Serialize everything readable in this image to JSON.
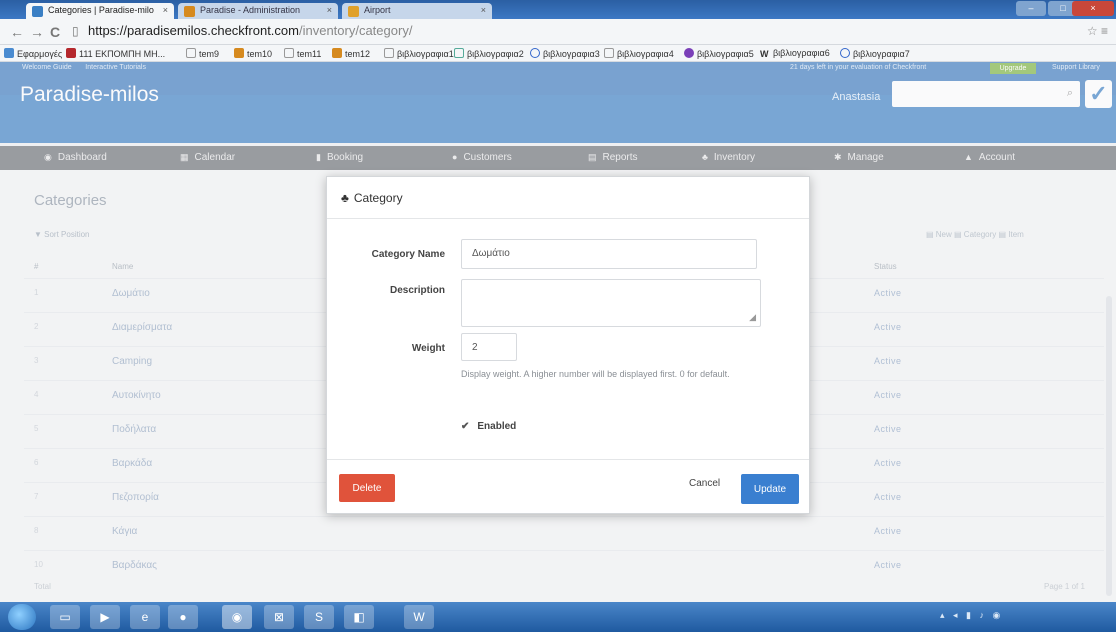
{
  "browser": {
    "tabs": [
      {
        "title": "Categories | Paradise-milo",
        "active": true,
        "favicon_color": "#3a7fc4"
      },
      {
        "title": "Paradise - Administration",
        "active": false,
        "favicon_color": "#d68a1f"
      },
      {
        "title": "Airport",
        "active": false,
        "favicon_color": "#e0a12b"
      }
    ],
    "url_host": "https://paradisemilos.checkfront.com",
    "url_path": "/inventory/category/",
    "bookmarks": [
      "Εφαρμογές",
      "111 ΕΚΠΟΜΠΗ ΜΗ...",
      "tem9",
      "tem10",
      "tem11",
      "tem12",
      "βιβλιογραφια1",
      "βιβλιογραφια2",
      "βιβλιογραφια3",
      "βιβλιογραφια4",
      "βιβλιογραφια5",
      "βιβλιογραφια6",
      "βιβλιογραφια7"
    ]
  },
  "app": {
    "top_links": [
      "Welcome Guide",
      "Interactive Tutorials"
    ],
    "trial_text": "21 days left in your evaluation of Checkfront",
    "upgrade_label": "Upgrade",
    "support_label": "Support Library",
    "brand": "Paradise-milos",
    "user": "Anastasia",
    "nav": [
      "Dashboard",
      "Calendar",
      "Booking",
      "Customers",
      "Reports",
      "Inventory",
      "Manage",
      "Account"
    ]
  },
  "background": {
    "page_title": "Categories",
    "filter": "▼ Sort Position",
    "right_buttons": "▤ New   ▤ Category   ▤ Item",
    "col_name": "Name",
    "col_status": "Status",
    "rows": [
      {
        "name": "Δωμάτιο",
        "status": "Active"
      },
      {
        "name": "Διαμερίσματα",
        "status": "Active"
      },
      {
        "name": "Camping",
        "status": "Active"
      },
      {
        "name": "Αυτοκίνητο",
        "status": "Active"
      },
      {
        "name": "Ποδήλατα",
        "status": "Active"
      },
      {
        "name": "Βαρκάδα",
        "status": "Active"
      },
      {
        "name": "Πεζοπορία",
        "status": "Active"
      },
      {
        "name": "Κάγια",
        "status": "Active"
      },
      {
        "name": "Βαρδάκας",
        "status": "Active"
      }
    ],
    "footer": "Total",
    "pager": "Page 1 of 1"
  },
  "modal": {
    "title": "Category",
    "labels": {
      "name": "Category Name",
      "description": "Description",
      "weight": "Weight"
    },
    "values": {
      "name": "Δωμάτιο",
      "description": "",
      "weight": "2"
    },
    "help": "Display weight. A higher number will be displayed first. 0 for default.",
    "enabled_label": "Enabled",
    "delete_label": "Delete",
    "cancel_label": "Cancel",
    "update_label": "Update"
  }
}
